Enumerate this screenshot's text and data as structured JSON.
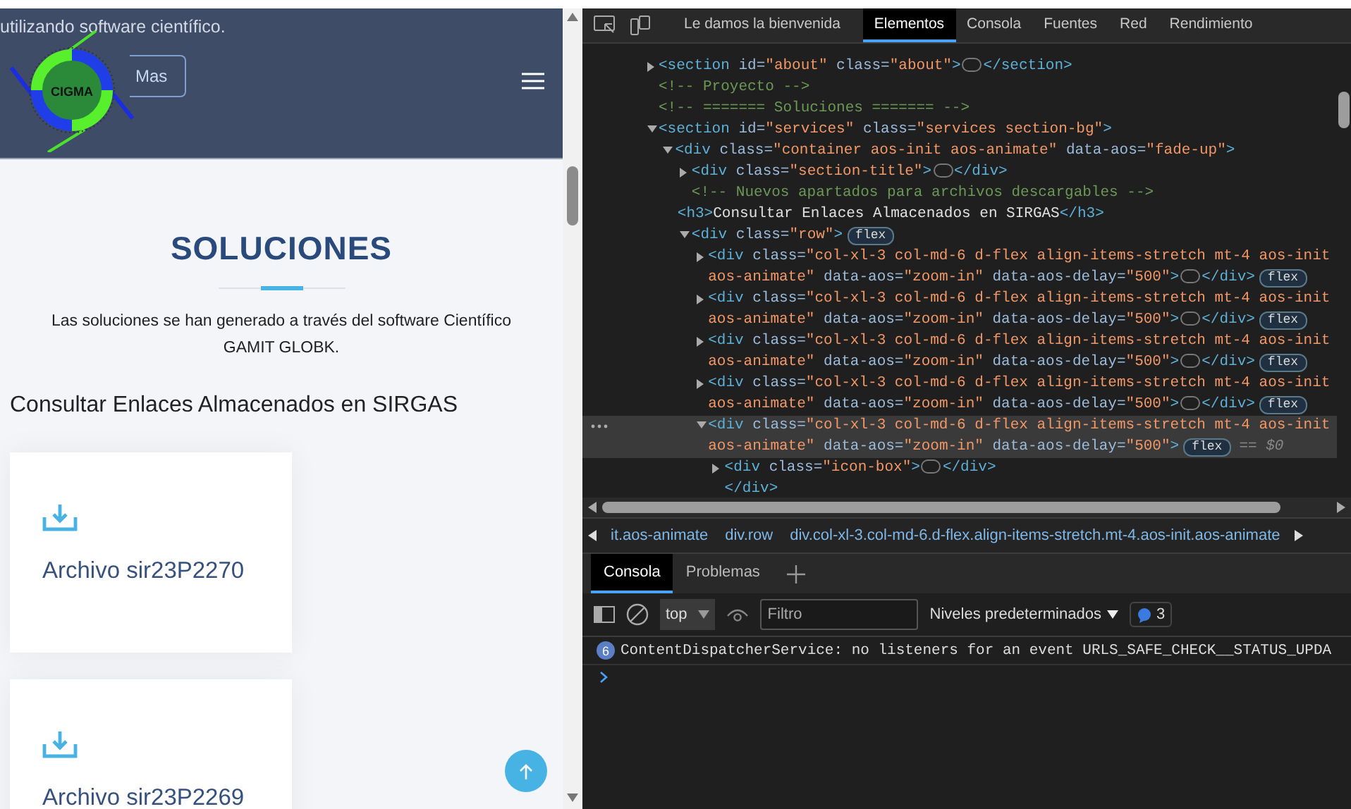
{
  "page": {
    "intro_text": "utilizando software científico.",
    "intro_button": "Mas",
    "logo_text": "CIGMA",
    "section_title": "SOLUCIONES",
    "section_text": "Las soluciones se han generado a través del software Científico GAMIT GLOBK.",
    "heading": "Consultar Enlaces Almacenados en SIRGAS",
    "cards": [
      {
        "title": "Archivo sir23P2270"
      },
      {
        "title": "Archivo sir23P2269"
      }
    ]
  },
  "devtools": {
    "tabs": [
      {
        "label": "Le damos la bienvenida",
        "selected": false
      },
      {
        "label": "Elementos",
        "selected": true
      },
      {
        "label": "Consola",
        "selected": false
      },
      {
        "label": "Fuentes",
        "selected": false
      },
      {
        "label": "Red",
        "selected": false
      },
      {
        "label": "Rendimiento",
        "selected": false
      }
    ],
    "dom_tree": [
      {
        "kind": "element",
        "text": "<section id=\"about\" class=\"about\">",
        "expanded": false,
        "collapsed_tail": "</section>",
        "selected": false
      },
      {
        "kind": "comment",
        "text": "<!-- Proyecto -->"
      },
      {
        "kind": "comment",
        "text": "<!-- ======= Soluciones ======= -->"
      },
      {
        "kind": "element",
        "text": "<section id=\"services\" class=\"services section-bg\">",
        "expanded": true,
        "selected": false,
        "children": [
          {
            "kind": "element",
            "text": "<div class=\"container aos-init aos-animate\" data-aos=\"fade-up\">",
            "expanded": true,
            "selected": false,
            "children": [
              {
                "kind": "element",
                "text": "<div class=\"section-title\">",
                "expanded": false,
                "collapsed_tail": "</div>",
                "selected": false
              },
              {
                "kind": "comment",
                "text": "<!-- Nuevos apartados para archivos descargables -->"
              },
              {
                "kind": "element",
                "text": "<h3>Consultar Enlaces Almacenados en SIRGAS</h3>",
                "selected": false
              },
              {
                "kind": "element",
                "text": "<div class=\"row\">",
                "expanded": true,
                "badge": "flex",
                "selected": false,
                "children": [
                  {
                    "kind": "element",
                    "text": "<div class=\"col-xl-3 col-md-6 d-flex align-items-stretch mt-4 aos-init aos-animate\" data-aos=\"zoom-in\" data-aos-delay=\"500\">",
                    "expanded": false,
                    "collapsed_tail": "</div>",
                    "badge": "flex",
                    "selected": false
                  },
                  {
                    "kind": "element",
                    "text": "<div class=\"col-xl-3 col-md-6 d-flex align-items-stretch mt-4 aos-init aos-animate\" data-aos=\"zoom-in\" data-aos-delay=\"500\">",
                    "expanded": false,
                    "collapsed_tail": "</div>",
                    "badge": "flex",
                    "selected": false
                  },
                  {
                    "kind": "element",
                    "text": "<div class=\"col-xl-3 col-md-6 d-flex align-items-stretch mt-4 aos-init aos-animate\" data-aos=\"zoom-in\" data-aos-delay=\"500\">",
                    "expanded": false,
                    "collapsed_tail": "</div>",
                    "badge": "flex",
                    "selected": false
                  },
                  {
                    "kind": "element",
                    "text": "<div class=\"col-xl-3 col-md-6 d-flex align-items-stretch mt-4 aos-init aos-animate\" data-aos=\"zoom-in\" data-aos-delay=\"500\">",
                    "expanded": false,
                    "collapsed_tail": "</div>",
                    "badge": "flex",
                    "selected": false
                  },
                  {
                    "kind": "element",
                    "text": "<div class=\"col-xl-3 col-md-6 d-flex align-items-stretch mt-4 aos-init aos-animate\" data-aos=\"zoom-in\" data-aos-delay=\"500\">",
                    "expanded": true,
                    "badge": "flex",
                    "marker": "== $0",
                    "selected": true,
                    "children": [
                      {
                        "kind": "element",
                        "text": "<div class=\"icon-box\">",
                        "expanded": false,
                        "collapsed_tail": "</div>",
                        "selected": false
                      },
                      {
                        "kind": "closing",
                        "text": "</div>"
                      }
                    ]
                  }
                ]
              }
            ]
          }
        ]
      }
    ],
    "breadcrumbs": [
      "it.aos-animate",
      "div.row",
      "div.col-xl-3.col-md-6.d-flex.align-items-stretch.mt-4.aos-init.aos-animate"
    ],
    "drawer_tabs": [
      {
        "label": "Consola",
        "selected": true
      },
      {
        "label": "Problemas",
        "selected": false
      }
    ],
    "context": "top",
    "filter_placeholder": "Filtro",
    "levels": "Niveles predeterminados",
    "issues_count": "3",
    "messages": [
      {
        "count": "6",
        "text": "ContentDispatcherService: no listeners for an event URLS_SAFE_CHECK__STATUS_UPDA"
      }
    ]
  }
}
